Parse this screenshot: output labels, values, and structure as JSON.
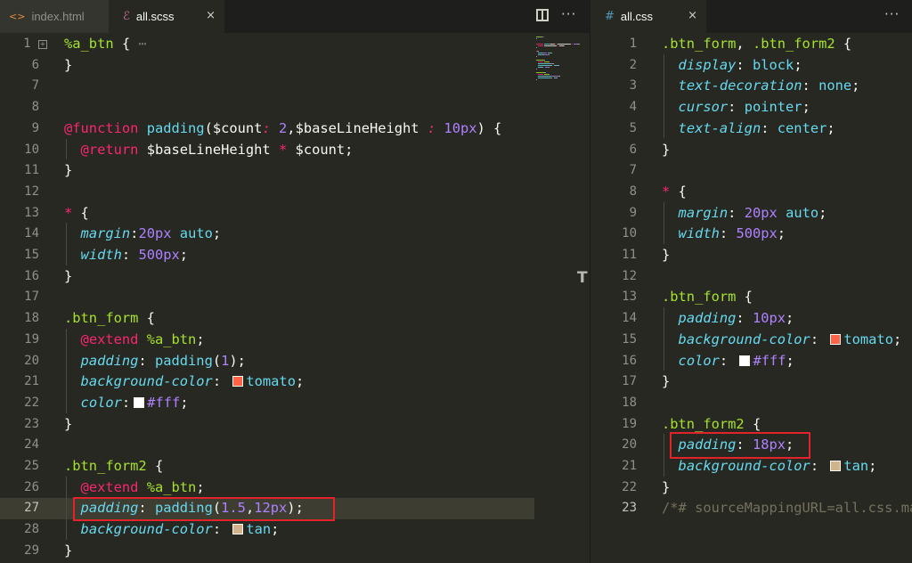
{
  "left_pane": {
    "tabs": [
      {
        "label": "index.html",
        "icon": "<>",
        "active": false
      },
      {
        "label": "all.scss",
        "icon": "sass",
        "active": true,
        "close": "×"
      }
    ],
    "lines": [
      {
        "n": "1",
        "fold": "+",
        "tokens": [
          [
            "sel",
            "%a_btn"
          ],
          [
            "punc",
            " {"
          ],
          [
            "cmt",
            " ⋯"
          ]
        ]
      },
      {
        "n": "6",
        "tokens": [
          [
            "punc",
            "}"
          ]
        ]
      },
      {
        "n": "7",
        "tokens": []
      },
      {
        "n": "8",
        "tokens": []
      },
      {
        "n": "9",
        "tokens": [
          [
            "kw",
            "@function"
          ],
          [
            "punc",
            " "
          ],
          [
            "fn",
            "padding"
          ],
          [
            "punc",
            "("
          ],
          [
            "var",
            "$count"
          ],
          [
            "ital-op",
            ":"
          ],
          [
            "punc",
            " "
          ],
          [
            "num",
            "2"
          ],
          [
            "punc",
            ","
          ],
          [
            "var",
            "$baseLineHeight"
          ],
          [
            "punc",
            " "
          ],
          [
            "ital-op",
            ":"
          ],
          [
            "punc",
            " "
          ],
          [
            "num",
            "10px"
          ],
          [
            "punc",
            ") {"
          ]
        ]
      },
      {
        "n": "10",
        "tokens": [
          [
            "punc",
            "  "
          ],
          [
            "kw",
            "@return"
          ],
          [
            "punc",
            " "
          ],
          [
            "var",
            "$baseLineHeight"
          ],
          [
            "punc",
            " "
          ],
          [
            "op",
            "*"
          ],
          [
            "punc",
            " "
          ],
          [
            "var",
            "$count"
          ],
          [
            "punc",
            ";"
          ]
        ]
      },
      {
        "n": "11",
        "tokens": [
          [
            "punc",
            "}"
          ]
        ]
      },
      {
        "n": "12",
        "tokens": []
      },
      {
        "n": "13",
        "tokens": [
          [
            "kw",
            "*"
          ],
          [
            "punc",
            " {"
          ]
        ]
      },
      {
        "n": "14",
        "tokens": [
          [
            "punc",
            "  "
          ],
          [
            "prop",
            "margin"
          ],
          [
            "punc",
            ":"
          ],
          [
            "num",
            "20px"
          ],
          [
            "punc",
            " "
          ],
          [
            "fn",
            "auto"
          ],
          [
            "punc",
            ";"
          ]
        ]
      },
      {
        "n": "15",
        "tokens": [
          [
            "punc",
            "  "
          ],
          [
            "prop",
            "width"
          ],
          [
            "punc",
            ": "
          ],
          [
            "num",
            "500px"
          ],
          [
            "punc",
            ";"
          ]
        ]
      },
      {
        "n": "16",
        "tokens": [
          [
            "punc",
            "}"
          ]
        ]
      },
      {
        "n": "17",
        "tokens": []
      },
      {
        "n": "18",
        "tokens": [
          [
            "sel",
            ".btn_form"
          ],
          [
            "punc",
            " {"
          ]
        ]
      },
      {
        "n": "19",
        "tokens": [
          [
            "punc",
            "  "
          ],
          [
            "kw",
            "@extend"
          ],
          [
            "punc",
            " "
          ],
          [
            "sel",
            "%a_btn"
          ],
          [
            "punc",
            ";"
          ]
        ]
      },
      {
        "n": "20",
        "tokens": [
          [
            "punc",
            "  "
          ],
          [
            "prop",
            "padding"
          ],
          [
            "punc",
            ": "
          ],
          [
            "fn",
            "padding"
          ],
          [
            "punc",
            "("
          ],
          [
            "num",
            "1"
          ],
          [
            "punc",
            ");"
          ]
        ]
      },
      {
        "n": "21",
        "tokens": [
          [
            "punc",
            "  "
          ],
          [
            "prop",
            "background-color"
          ],
          [
            "punc",
            ": "
          ],
          [
            "swatch",
            "#ff6347"
          ],
          [
            "fn",
            "tomato"
          ],
          [
            "punc",
            ";"
          ]
        ]
      },
      {
        "n": "22",
        "tokens": [
          [
            "punc",
            "  "
          ],
          [
            "prop",
            "color"
          ],
          [
            "punc",
            ":"
          ],
          [
            "swatch",
            "#ffffff"
          ],
          [
            "num",
            "#fff"
          ],
          [
            "punc",
            ";"
          ]
        ]
      },
      {
        "n": "23",
        "tokens": [
          [
            "punc",
            "}"
          ]
        ]
      },
      {
        "n": "24",
        "tokens": []
      },
      {
        "n": "25",
        "tokens": [
          [
            "sel",
            ".btn_form2"
          ],
          [
            "punc",
            " {"
          ]
        ]
      },
      {
        "n": "26",
        "tokens": [
          [
            "punc",
            "  "
          ],
          [
            "kw",
            "@extend"
          ],
          [
            "punc",
            " "
          ],
          [
            "sel",
            "%a_btn"
          ],
          [
            "punc",
            ";"
          ]
        ]
      },
      {
        "n": "27",
        "current": true,
        "tokens": [
          [
            "punc",
            "  "
          ],
          [
            "prop",
            "padding"
          ],
          [
            "punc",
            ": "
          ],
          [
            "fn",
            "padding"
          ],
          [
            "punc",
            "("
          ],
          [
            "num",
            "1.5"
          ],
          [
            "punc",
            ","
          ],
          [
            "num",
            "12px"
          ],
          [
            "punc",
            ");"
          ]
        ]
      },
      {
        "n": "28",
        "tokens": [
          [
            "punc",
            "  "
          ],
          [
            "prop",
            "background-color"
          ],
          [
            "punc",
            ": "
          ],
          [
            "swatch",
            "#d2b48c"
          ],
          [
            "fn",
            "tan"
          ],
          [
            "punc",
            ";"
          ]
        ]
      },
      {
        "n": "29",
        "tokens": [
          [
            "punc",
            "}"
          ]
        ]
      }
    ]
  },
  "right_pane": {
    "tabs": [
      {
        "label": "all.css",
        "icon": "#",
        "active": true,
        "close": "×"
      }
    ],
    "more_label": "···",
    "lines": [
      {
        "n": "1",
        "tokens": [
          [
            "sel",
            ".btn_form"
          ],
          [
            "punc",
            ", "
          ],
          [
            "sel",
            ".btn_form2"
          ],
          [
            "punc",
            " {"
          ]
        ]
      },
      {
        "n": "2",
        "tokens": [
          [
            "punc",
            "  "
          ],
          [
            "prop",
            "display"
          ],
          [
            "punc",
            ": "
          ],
          [
            "fn",
            "block"
          ],
          [
            "punc",
            ";"
          ]
        ]
      },
      {
        "n": "3",
        "tokens": [
          [
            "punc",
            "  "
          ],
          [
            "prop",
            "text-decoration"
          ],
          [
            "punc",
            ": "
          ],
          [
            "fn",
            "none"
          ],
          [
            "punc",
            ";"
          ]
        ]
      },
      {
        "n": "4",
        "tokens": [
          [
            "punc",
            "  "
          ],
          [
            "prop",
            "cursor"
          ],
          [
            "punc",
            ": "
          ],
          [
            "fn",
            "pointer"
          ],
          [
            "punc",
            ";"
          ]
        ]
      },
      {
        "n": "5",
        "tokens": [
          [
            "punc",
            "  "
          ],
          [
            "prop",
            "text-align"
          ],
          [
            "punc",
            ": "
          ],
          [
            "fn",
            "center"
          ],
          [
            "punc",
            ";"
          ]
        ]
      },
      {
        "n": "6",
        "tokens": [
          [
            "punc",
            "}"
          ]
        ]
      },
      {
        "n": "7",
        "tokens": []
      },
      {
        "n": "8",
        "tokens": [
          [
            "kw",
            "*"
          ],
          [
            "punc",
            " {"
          ]
        ]
      },
      {
        "n": "9",
        "tokens": [
          [
            "punc",
            "  "
          ],
          [
            "prop",
            "margin"
          ],
          [
            "punc",
            ": "
          ],
          [
            "num",
            "20px"
          ],
          [
            "punc",
            " "
          ],
          [
            "fn",
            "auto"
          ],
          [
            "punc",
            ";"
          ]
        ]
      },
      {
        "n": "10",
        "tokens": [
          [
            "punc",
            "  "
          ],
          [
            "prop",
            "width"
          ],
          [
            "punc",
            ": "
          ],
          [
            "num",
            "500px"
          ],
          [
            "punc",
            ";"
          ]
        ]
      },
      {
        "n": "11",
        "tokens": [
          [
            "punc",
            "}"
          ]
        ]
      },
      {
        "n": "12",
        "tokens": []
      },
      {
        "n": "13",
        "tokens": [
          [
            "sel",
            ".btn_form"
          ],
          [
            "punc",
            " {"
          ]
        ]
      },
      {
        "n": "14",
        "tokens": [
          [
            "punc",
            "  "
          ],
          [
            "prop",
            "padding"
          ],
          [
            "punc",
            ": "
          ],
          [
            "num",
            "10px"
          ],
          [
            "punc",
            ";"
          ]
        ]
      },
      {
        "n": "15",
        "tokens": [
          [
            "punc",
            "  "
          ],
          [
            "prop",
            "background-color"
          ],
          [
            "punc",
            ": "
          ],
          [
            "swatch",
            "#ff6347"
          ],
          [
            "fn",
            "tomato"
          ],
          [
            "punc",
            ";"
          ]
        ]
      },
      {
        "n": "16",
        "tokens": [
          [
            "punc",
            "  "
          ],
          [
            "prop",
            "color"
          ],
          [
            "punc",
            ": "
          ],
          [
            "swatch",
            "#ffffff"
          ],
          [
            "num",
            "#fff"
          ],
          [
            "punc",
            ";"
          ]
        ]
      },
      {
        "n": "17",
        "tokens": [
          [
            "punc",
            "}"
          ]
        ]
      },
      {
        "n": "18",
        "tokens": []
      },
      {
        "n": "19",
        "tokens": [
          [
            "sel",
            ".btn_form2"
          ],
          [
            "punc",
            " {"
          ]
        ]
      },
      {
        "n": "20",
        "tokens": [
          [
            "punc",
            "  "
          ],
          [
            "prop",
            "padding"
          ],
          [
            "punc",
            ": "
          ],
          [
            "num",
            "18px"
          ],
          [
            "punc",
            ";"
          ]
        ]
      },
      {
        "n": "21",
        "tokens": [
          [
            "punc",
            "  "
          ],
          [
            "prop",
            "background-color"
          ],
          [
            "punc",
            ": "
          ],
          [
            "swatch",
            "#d2b48c"
          ],
          [
            "fn",
            "tan"
          ],
          [
            "punc",
            ";"
          ]
        ]
      },
      {
        "n": "22",
        "tokens": [
          [
            "punc",
            "}"
          ]
        ]
      },
      {
        "n": "23",
        "current": true,
        "tokens": [
          [
            "cmt",
            "/*# sourceMappingURL=all.css.map */"
          ]
        ]
      }
    ]
  },
  "colors": {
    "background": "#272822",
    "tab_bar": "#1e1f1c",
    "current_line": "#3e3d32",
    "annotation_box": "#e3232a"
  }
}
